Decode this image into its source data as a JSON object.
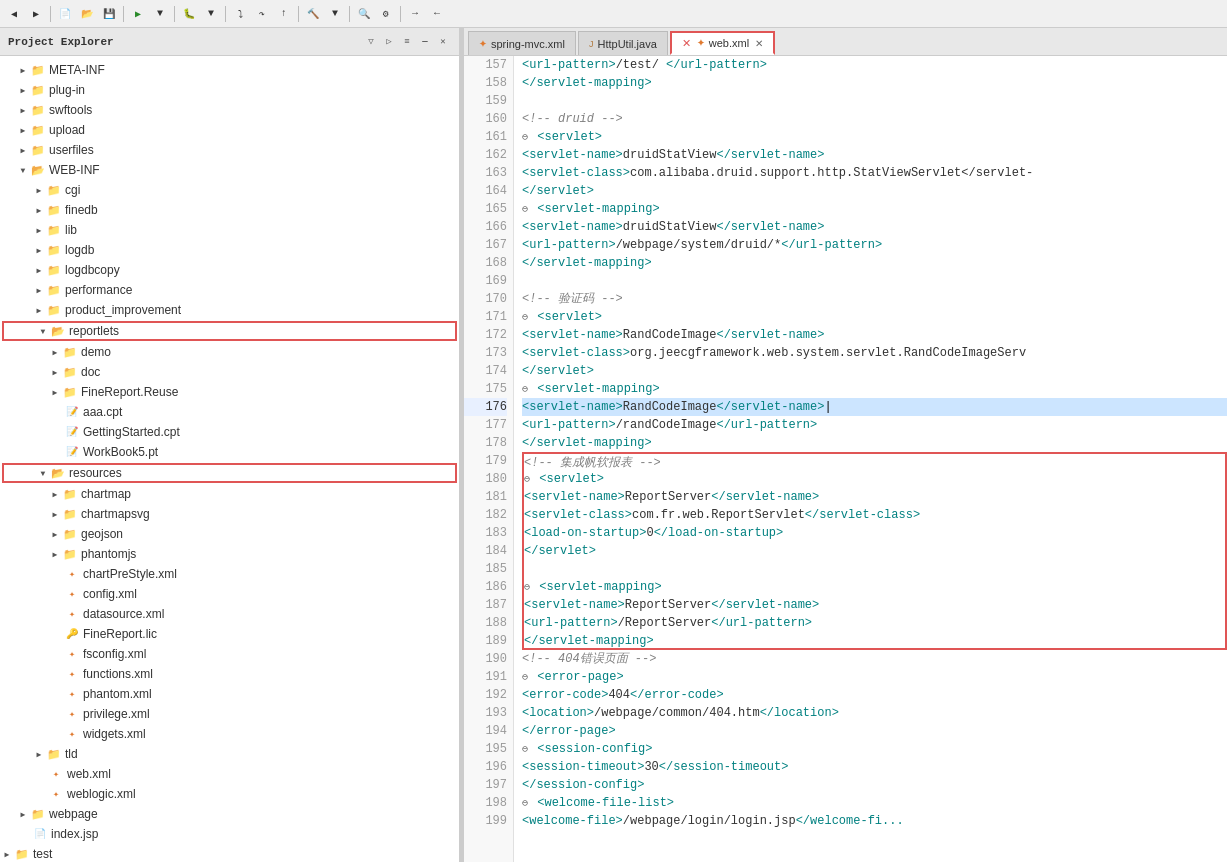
{
  "toolbar": {
    "buttons": [
      "◀",
      "▶",
      "⟳",
      "◼",
      "❚❚",
      "⏩",
      "⏭",
      "⬛",
      "▶▶",
      "⛔",
      "💡",
      "🔧",
      "📋",
      "📌",
      "⚡",
      "🔍",
      "🔎",
      "⚙",
      "🐞",
      "🔖",
      "⭐",
      "📂",
      "💾",
      "🖨",
      "✂",
      "📄",
      "🗑",
      "↩",
      "↪"
    ]
  },
  "left_panel": {
    "title": "Project Explorer",
    "close_label": "✕",
    "tree": [
      {
        "id": "meta-inf",
        "label": "META-INF",
        "indent": 1,
        "type": "folder",
        "expanded": false
      },
      {
        "id": "plug-in",
        "label": "plug-in",
        "indent": 1,
        "type": "folder",
        "expanded": false
      },
      {
        "id": "swftools",
        "label": "swftools",
        "indent": 1,
        "type": "folder",
        "expanded": false
      },
      {
        "id": "upload",
        "label": "upload",
        "indent": 1,
        "type": "folder",
        "expanded": false
      },
      {
        "id": "userfiles",
        "label": "userfiles",
        "indent": 1,
        "type": "folder",
        "expanded": false
      },
      {
        "id": "web-inf",
        "label": "WEB-INF",
        "indent": 1,
        "type": "folder",
        "expanded": true
      },
      {
        "id": "cgi",
        "label": "cgi",
        "indent": 2,
        "type": "folder",
        "expanded": false
      },
      {
        "id": "finedb",
        "label": "finedb",
        "indent": 2,
        "type": "folder",
        "expanded": false
      },
      {
        "id": "lib",
        "label": "lib",
        "indent": 2,
        "type": "folder",
        "expanded": false
      },
      {
        "id": "logdb",
        "label": "logdb",
        "indent": 2,
        "type": "folder",
        "expanded": false
      },
      {
        "id": "logdbcopy",
        "label": "logdbcopy",
        "indent": 2,
        "type": "folder",
        "expanded": false
      },
      {
        "id": "performance",
        "label": "performance",
        "indent": 2,
        "type": "folder",
        "expanded": false
      },
      {
        "id": "product-improvement",
        "label": "product_improvement",
        "indent": 2,
        "type": "folder",
        "expanded": false
      },
      {
        "id": "reportlets",
        "label": "reportlets",
        "indent": 2,
        "type": "folder",
        "expanded": true,
        "boxed": true
      },
      {
        "id": "demo",
        "label": "demo",
        "indent": 3,
        "type": "folder",
        "expanded": false
      },
      {
        "id": "doc",
        "label": "doc",
        "indent": 3,
        "type": "folder",
        "expanded": false
      },
      {
        "id": "finereport-reuse",
        "label": "FineReport.Reuse",
        "indent": 3,
        "type": "folder",
        "expanded": false
      },
      {
        "id": "aaa-cpt",
        "label": "aaa.cpt",
        "indent": 3,
        "type": "cpt"
      },
      {
        "id": "getting-started",
        "label": "GettingStarted.cpt",
        "indent": 3,
        "type": "cpt"
      },
      {
        "id": "workbook5",
        "label": "WorkBook5.pt",
        "indent": 3,
        "type": "cpt"
      },
      {
        "id": "resources",
        "label": "resources",
        "indent": 2,
        "type": "folder",
        "expanded": true,
        "boxed": true
      },
      {
        "id": "chartmap",
        "label": "chartmap",
        "indent": 3,
        "type": "folder",
        "expanded": false
      },
      {
        "id": "chartmapsvg",
        "label": "chartmapsvg",
        "indent": 3,
        "type": "folder",
        "expanded": false
      },
      {
        "id": "geojson",
        "label": "geojson",
        "indent": 3,
        "type": "folder",
        "expanded": false
      },
      {
        "id": "phantomjs",
        "label": "phantomjs",
        "indent": 3,
        "type": "folder",
        "expanded": false
      },
      {
        "id": "chartprestyle",
        "label": "chartPreStyle.xml",
        "indent": 3,
        "type": "xml"
      },
      {
        "id": "config",
        "label": "config.xml",
        "indent": 3,
        "type": "xml"
      },
      {
        "id": "datasource",
        "label": "datasource.xml",
        "indent": 3,
        "type": "xml"
      },
      {
        "id": "finereport-lic",
        "label": "FineReport.lic",
        "indent": 3,
        "type": "lic"
      },
      {
        "id": "fsconfig",
        "label": "fsconfig.xml",
        "indent": 3,
        "type": "xml"
      },
      {
        "id": "functions",
        "label": "functions.xml",
        "indent": 3,
        "type": "xml"
      },
      {
        "id": "phantom",
        "label": "phantom.xml",
        "indent": 3,
        "type": "xml"
      },
      {
        "id": "privilege",
        "label": "privilege.xml",
        "indent": 3,
        "type": "xml"
      },
      {
        "id": "widgets",
        "label": "widgets.xml",
        "indent": 3,
        "type": "xml"
      },
      {
        "id": "tld",
        "label": "tld",
        "indent": 2,
        "type": "folder",
        "expanded": false
      },
      {
        "id": "web-xml",
        "label": "web.xml",
        "indent": 2,
        "type": "xml"
      },
      {
        "id": "weblogic-xml",
        "label": "weblogic.xml",
        "indent": 2,
        "type": "xml"
      },
      {
        "id": "webpage",
        "label": "webpage",
        "indent": 1,
        "type": "folder",
        "expanded": false
      },
      {
        "id": "index-jsp",
        "label": "index.jsp",
        "indent": 1,
        "type": "jsp"
      },
      {
        "id": "test",
        "label": "test",
        "indent": 0,
        "type": "folder",
        "expanded": false
      }
    ]
  },
  "editor": {
    "tabs": [
      {
        "id": "spring-mvc",
        "label": "spring-mvc.xml",
        "type": "xml",
        "active": false,
        "closeable": false
      },
      {
        "id": "httputil",
        "label": "HttpUtil.java",
        "type": "java",
        "active": false,
        "closeable": false
      },
      {
        "id": "web-xml",
        "label": "web.xml",
        "type": "xml",
        "active": true,
        "closeable": true,
        "boxed": true
      }
    ],
    "lines": [
      {
        "num": 157,
        "content": "    <url-pattern>/test/ </url-pattern>",
        "fold": false
      },
      {
        "num": 158,
        "content": "  </servlet-mapping>",
        "fold": false
      },
      {
        "num": 159,
        "content": "",
        "fold": false
      },
      {
        "num": 160,
        "content": "  <!-- druid -->",
        "fold": false,
        "comment": true
      },
      {
        "num": 161,
        "content": "  <servlet>",
        "fold": true
      },
      {
        "num": 162,
        "content": "    <servlet-name>druidStatView</servlet-name>",
        "fold": false
      },
      {
        "num": 163,
        "content": "    <servlet-class>com.alibaba.druid.support.http.StatViewServlet</servlet-",
        "fold": false
      },
      {
        "num": 164,
        "content": "  </servlet>",
        "fold": false
      },
      {
        "num": 165,
        "content": "  <servlet-mapping>",
        "fold": true
      },
      {
        "num": 166,
        "content": "    <servlet-name>druidStatView</servlet-name>",
        "fold": false
      },
      {
        "num": 167,
        "content": "    <url-pattern>/webpage/system/druid/*</url-pattern>",
        "fold": false
      },
      {
        "num": 168,
        "content": "  </servlet-mapping>",
        "fold": false
      },
      {
        "num": 169,
        "content": "",
        "fold": false
      },
      {
        "num": 170,
        "content": "  <!-- 验证码 -->",
        "fold": false,
        "comment": true
      },
      {
        "num": 171,
        "content": "  <servlet>",
        "fold": true
      },
      {
        "num": 172,
        "content": "    <servlet-name>RandCodeImage</servlet-name>",
        "fold": false
      },
      {
        "num": 173,
        "content": "    <servlet-class>org.jeecgframework.web.system.servlet.RandCodeImageServ",
        "fold": false
      },
      {
        "num": 174,
        "content": "  </servlet>",
        "fold": false
      },
      {
        "num": 175,
        "content": "  <servlet-mapping>",
        "fold": true
      },
      {
        "num": 176,
        "content": "    <servlet-name>RandCodeImage</servlet-name>|",
        "fold": false,
        "highlight": true
      },
      {
        "num": 177,
        "content": "    <url-pattern>/randCodeImage</url-pattern>",
        "fold": false
      },
      {
        "num": 178,
        "content": "  </servlet-mapping>",
        "fold": false
      },
      {
        "num": 179,
        "content": "  <!-- 集成帆软报表 -->",
        "fold": false,
        "comment": true,
        "box_start": true
      },
      {
        "num": 180,
        "content": "  <servlet>",
        "fold": true,
        "box_content": true
      },
      {
        "num": 181,
        "content": "    <servlet-name>ReportServer</servlet-name>",
        "fold": false,
        "box_content": true
      },
      {
        "num": 182,
        "content": "    <servlet-class>com.fr.web.ReportServlet</servlet-class>",
        "fold": false,
        "box_content": true
      },
      {
        "num": 183,
        "content": "    <load-on-startup>0</load-on-startup>",
        "fold": false,
        "box_content": true
      },
      {
        "num": 184,
        "content": "  </servlet>",
        "fold": false,
        "box_content": true
      },
      {
        "num": 185,
        "content": "",
        "fold": false,
        "box_content": true
      },
      {
        "num": 186,
        "content": "  <servlet-mapping>",
        "fold": true,
        "box_content": true
      },
      {
        "num": 187,
        "content": "    <servlet-name>ReportServer</servlet-name>",
        "fold": false,
        "box_content": true
      },
      {
        "num": 188,
        "content": "    <url-pattern>/ReportServer</url-pattern>",
        "fold": false,
        "box_content": true
      },
      {
        "num": 189,
        "content": "  </servlet-mapping>",
        "fold": false,
        "box_end": true
      },
      {
        "num": 190,
        "content": "  <!-- 404错误页面 -->",
        "fold": false,
        "comment": true
      },
      {
        "num": 191,
        "content": "  <error-page>",
        "fold": true
      },
      {
        "num": 192,
        "content": "    <error-code>404</error-code>",
        "fold": false
      },
      {
        "num": 193,
        "content": "    <location>/webpage/common/404.htm</location>",
        "fold": false
      },
      {
        "num": 194,
        "content": "  </error-page>",
        "fold": false
      },
      {
        "num": 195,
        "content": "  <session-config>",
        "fold": true
      },
      {
        "num": 196,
        "content": "    <session-timeout>30</session-timeout>",
        "fold": false
      },
      {
        "num": 197,
        "content": "  </session-config>",
        "fold": false
      },
      {
        "num": 198,
        "content": "  <welcome-file-list>",
        "fold": true
      },
      {
        "num": 199,
        "content": "    <welcome-file>/webpage/login/login.jsp</welcome-fi...",
        "fold": false
      }
    ]
  }
}
